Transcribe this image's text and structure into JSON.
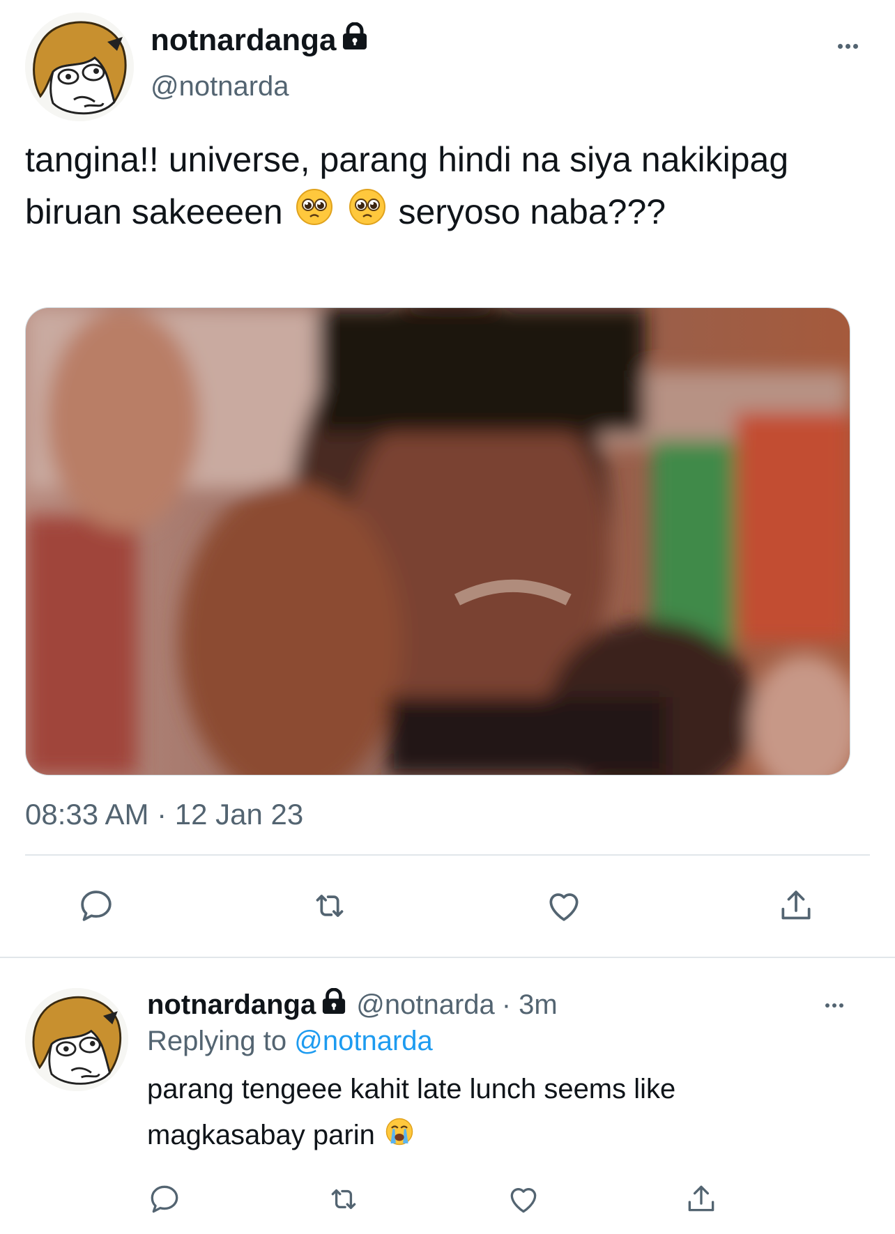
{
  "main_tweet": {
    "display_name": "notnardanga",
    "handle": "@notnarda",
    "text_part1": "tangina!! universe, parang hindi na siya nakikipag biruan sakeeeen",
    "text_part2": "seryoso naba???",
    "emojis": [
      "pleading-face",
      "pleading-face"
    ],
    "timestamp": "08:33 AM · 12 Jan 23",
    "media_description_icon": "meme-reaction-image"
  },
  "reply_tweet": {
    "display_name": "notnardanga",
    "handle": "@notnarda",
    "time": "· 3m",
    "replying_label": "Replying to",
    "replying_handle": "@notnarda",
    "text": "parang tengeee kahit late lunch seems like magkasabay parin",
    "emoji": "loudly-crying-face"
  },
  "actions": [
    "reply-icon",
    "retweet-icon",
    "like-icon",
    "share-icon"
  ],
  "colors": {
    "text": "#0f1419",
    "secondary": "#536471",
    "link": "#1d9bf0",
    "divider": "#e1e6ea"
  }
}
